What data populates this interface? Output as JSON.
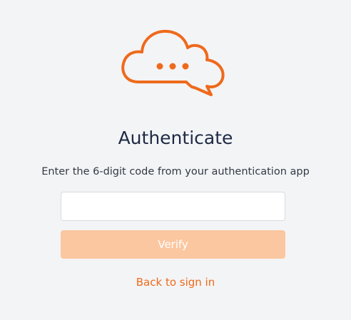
{
  "brand": {
    "accent_color": "#ee6a1b",
    "logo_icon": "chat-cloud-icon"
  },
  "heading": "Authenticate",
  "instructions": "Enter the 6-digit code from your authentication app",
  "code_input": {
    "value": "",
    "placeholder": ""
  },
  "verify_button": {
    "label": "Verify",
    "state": "disabled",
    "color": "#fbc7a0"
  },
  "back_link": {
    "label": "Back to sign in"
  }
}
